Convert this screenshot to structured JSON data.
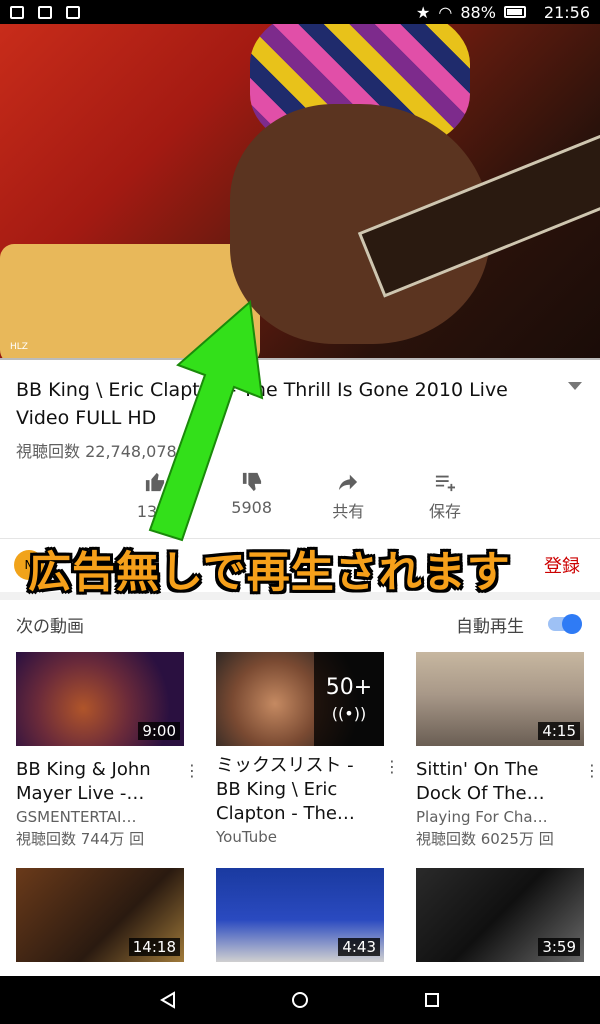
{
  "status_bar": {
    "battery": "88%",
    "time": "21:56"
  },
  "video": {
    "watermark": "HLZ",
    "progress": 0.0
  },
  "title": "BB King \\ Eric Clapton - The Thrill Is Gone 2010 Live Video FULL HD",
  "views": "視聴回数 22,748,078 回",
  "actions": {
    "like_count": "13万",
    "dislike_count": "5908",
    "share_label": "共有",
    "save_label": "保存"
  },
  "channel": {
    "avatar_letter": "N",
    "subscribe_label": "登録"
  },
  "overlay_caption": "広告無しで再生されます",
  "next_section": {
    "label": "次の動画",
    "autoplay_label": "自動再生",
    "autoplay_on": true
  },
  "videos": [
    {
      "title": "BB King & John Mayer Live -…",
      "channel": "GSMENTERTAI…",
      "views": "視聴回数 744万 回",
      "duration": "9:00"
    },
    {
      "title": "ミックスリスト - BB King \\ Eric Clapton - The…",
      "channel": "YouTube",
      "mix_count": "50+"
    },
    {
      "title": "Sittin' On The Dock Of The…",
      "channel": "Playing For Cha…",
      "views": "視聴回数 6025万 回",
      "duration": "4:15"
    }
  ],
  "row2_durations": [
    "14:18",
    "4:43",
    "3:59"
  ],
  "colors": {
    "accent_red": "#cc0000",
    "toggle_blue": "#2f7bf5",
    "caption_orange": "#f6a01a",
    "arrow_green": "#33e01a"
  }
}
